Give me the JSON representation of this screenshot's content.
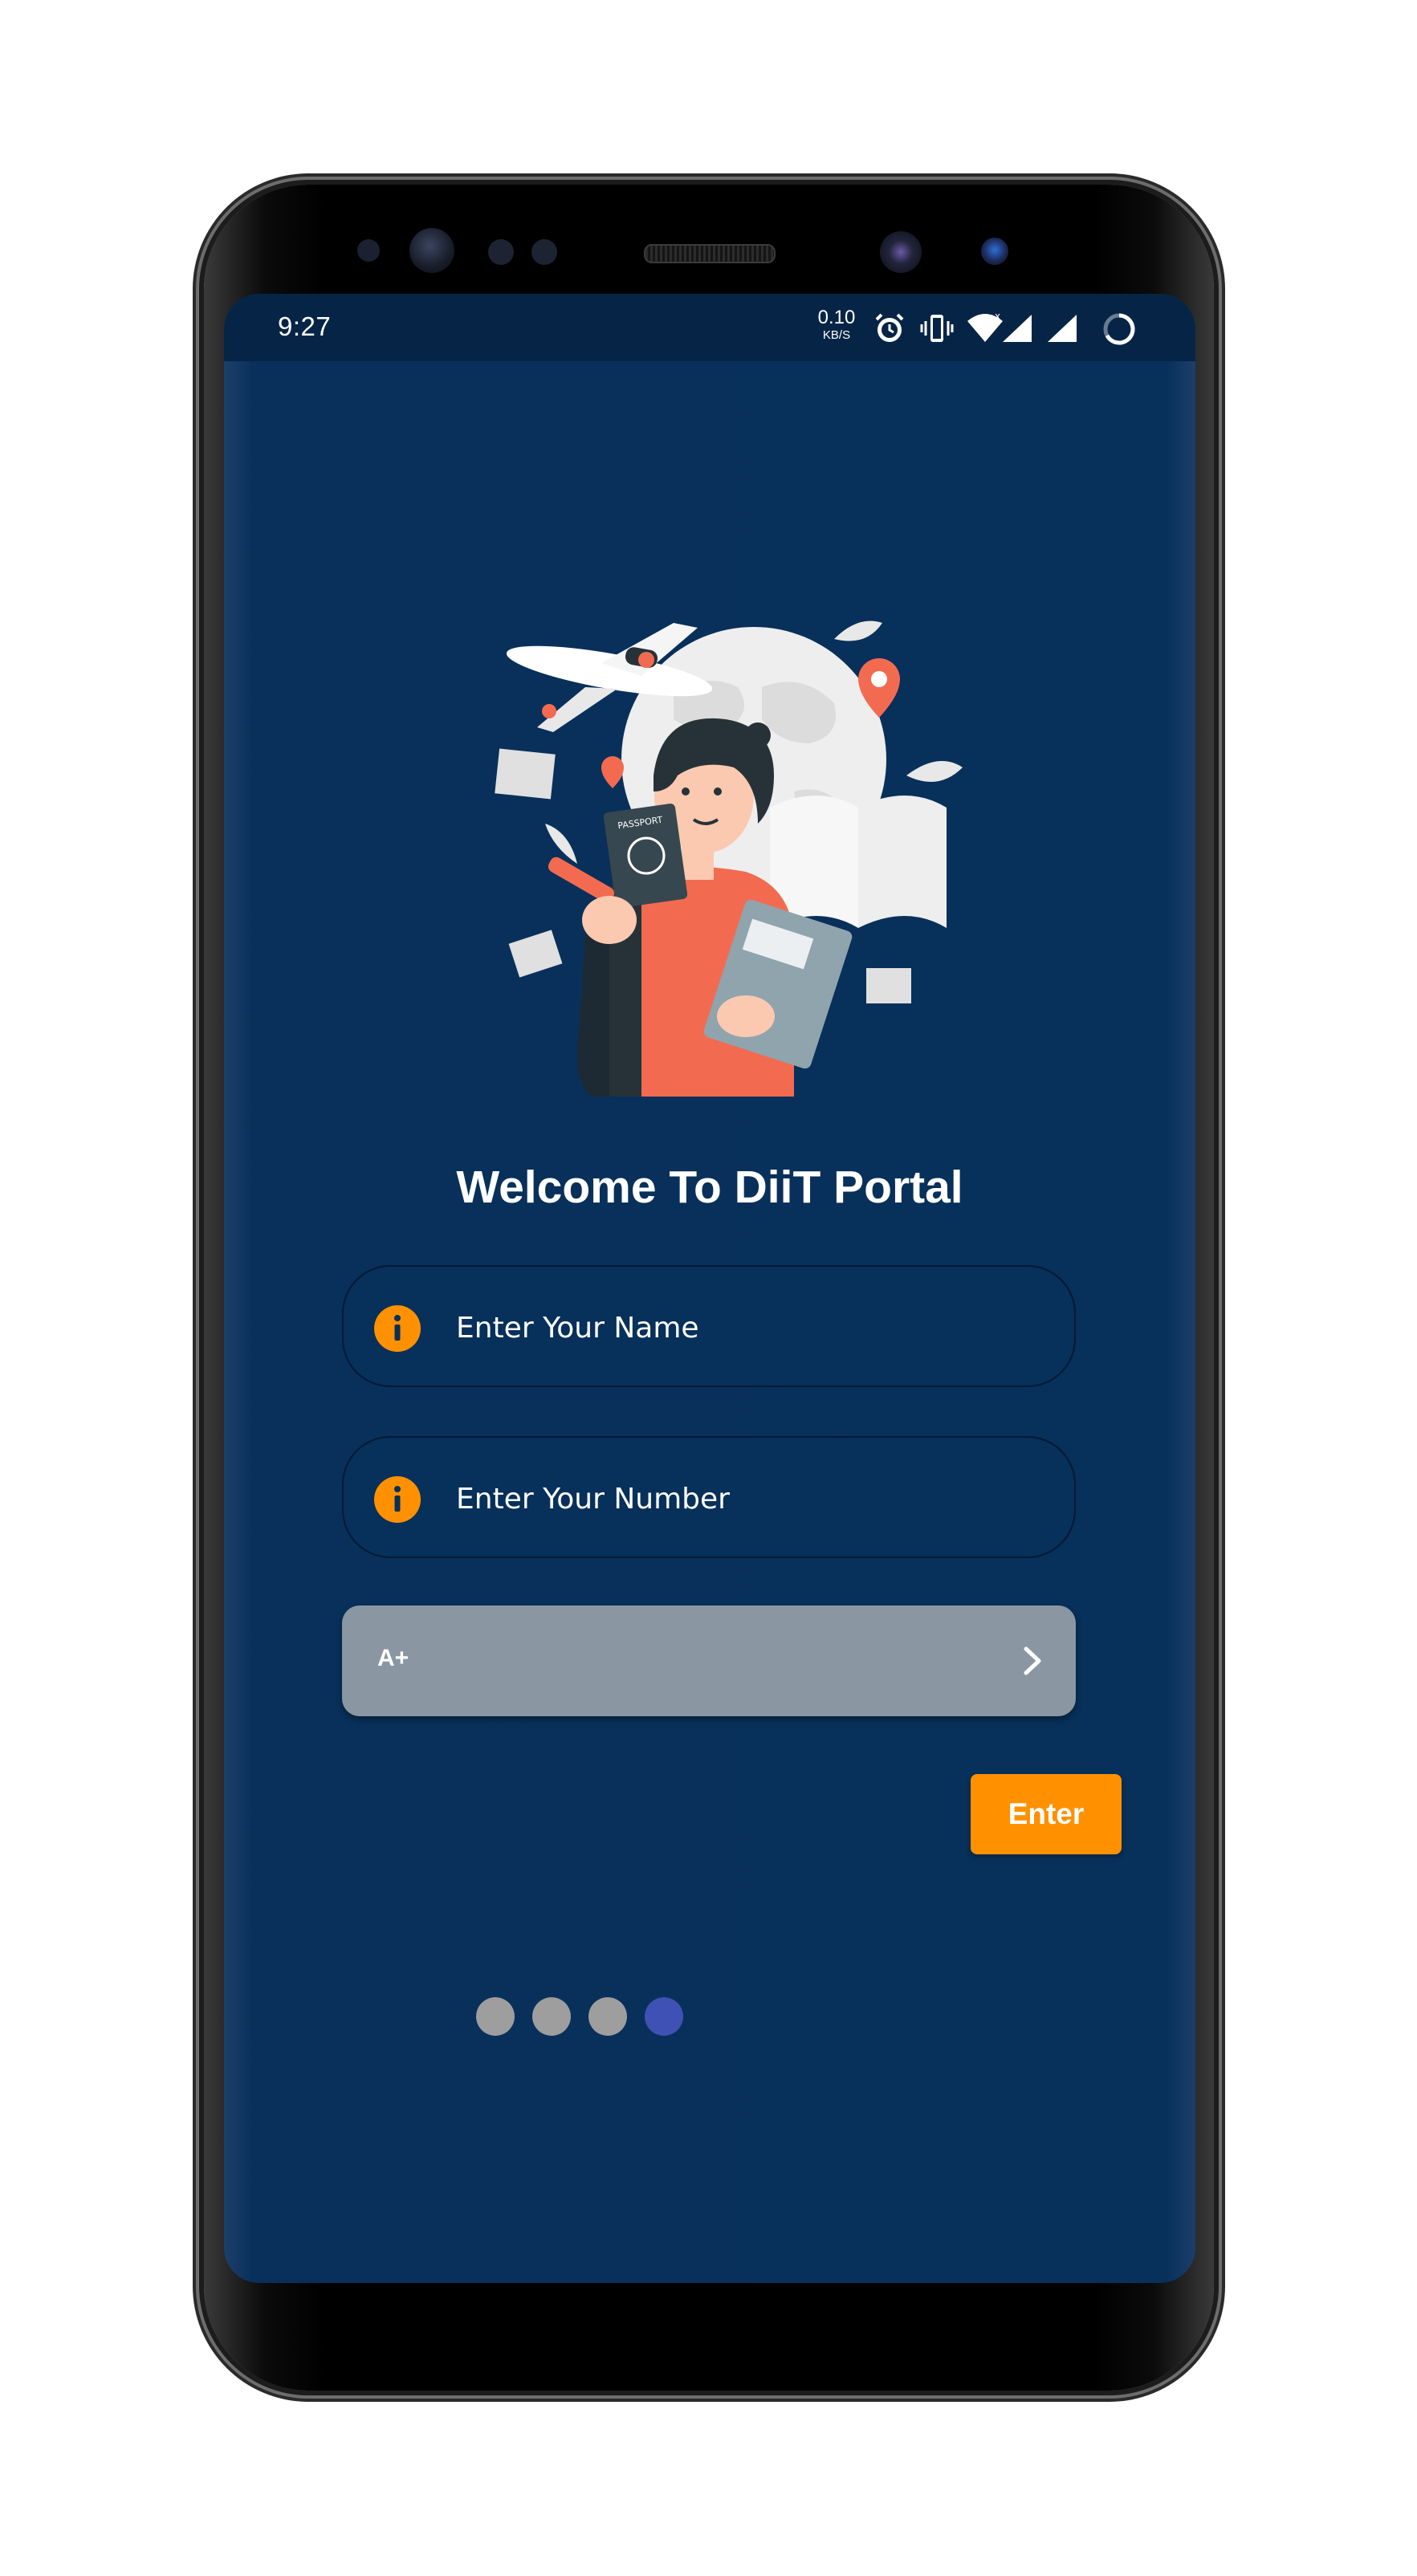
{
  "status_bar": {
    "time": "9:27",
    "net_speed_value": "0.10",
    "net_speed_unit": "KB/S",
    "icons": [
      "alarm-icon",
      "vibrate-icon",
      "wifi-icon",
      "signal-icon",
      "signal-icon",
      "battery-icon"
    ]
  },
  "illustration": {
    "icon": "student-travel-illustration"
  },
  "welcome": {
    "title": "Welcome To DiiT Portal"
  },
  "form": {
    "name_field": {
      "placeholder": "Enter Your Name",
      "value": "",
      "icon": "info-icon"
    },
    "number_field": {
      "placeholder": "Enter Your Number",
      "value": "",
      "icon": "info-icon"
    },
    "blood_group_select": {
      "selected": "A+",
      "icon": "chevron-right-icon"
    },
    "enter_button_label": "Enter"
  },
  "pager": {
    "total": 4,
    "active_index": 3
  },
  "colors": {
    "background": "#07305a",
    "status_bar": "#062546",
    "accent": "#ff9100",
    "select_bg": "#8a96a2",
    "active_dot": "#3f51b5",
    "inactive_dot": "#9e9e9e"
  }
}
